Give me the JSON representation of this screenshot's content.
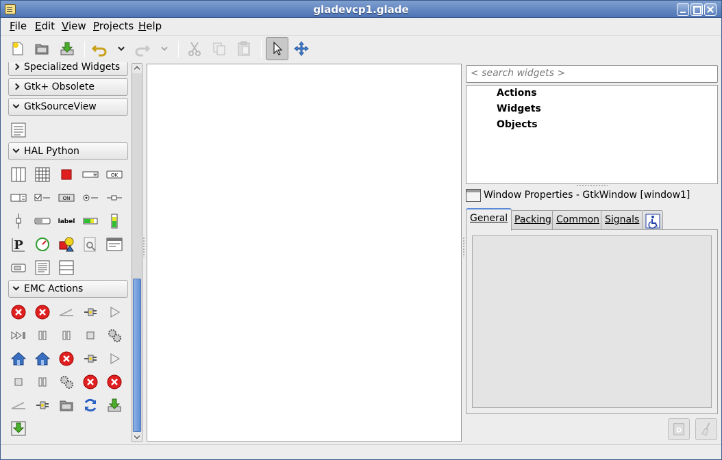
{
  "window": {
    "title": "gladevcp1.glade"
  },
  "menubar": {
    "items": [
      {
        "label": "File"
      },
      {
        "label": "Edit"
      },
      {
        "label": "View"
      },
      {
        "label": "Projects"
      },
      {
        "label": "Help"
      }
    ]
  },
  "palette": {
    "groups": [
      {
        "label": "Specialized Widgets"
      },
      {
        "label": "Gtk+ Obsolete"
      },
      {
        "label": "GtkSourceView"
      },
      {
        "label": "HAL Python"
      },
      {
        "label": "EMC Actions"
      }
    ],
    "text_icons": {
      "on": "ON",
      "ok": "OK",
      "label": "label"
    }
  },
  "inspector": {
    "search_placeholder": "< search widgets >",
    "items": [
      {
        "label": "Actions"
      },
      {
        "label": "Widgets"
      },
      {
        "label": "Objects"
      }
    ]
  },
  "properties": {
    "title": "Window Properties - GtkWindow [window1]",
    "tabs": [
      {
        "label": "General",
        "active": true
      },
      {
        "label": "Packing",
        "active": false
      },
      {
        "label": "Common",
        "active": false
      },
      {
        "label": "Signals",
        "active": false
      }
    ]
  },
  "colors": {
    "titlebar": "#5a7fbd",
    "accent": "#5a8ad8",
    "stop_red": "#e02020",
    "home_blue": "#3a6fc0"
  }
}
